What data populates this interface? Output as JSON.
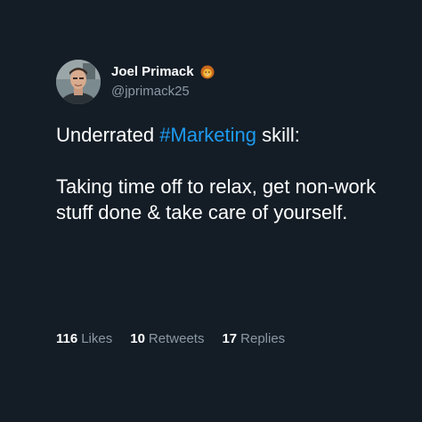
{
  "author": {
    "display_name": "Joel Primack",
    "handle": "@jprimack25",
    "avatar_icon": "profile-photo",
    "badge_icon": "lion-emoji"
  },
  "tweet": {
    "line1_prefix": "Underrated ",
    "hashtag": "#Marketing",
    "line1_suffix": " skill:",
    "line2": "Taking time off to relax, get non-work stuff done & take care of yourself."
  },
  "stats": {
    "likes_count": "116",
    "likes_label": "Likes",
    "retweets_count": "10",
    "retweets_label": "Retweets",
    "replies_count": "17",
    "replies_label": "Replies"
  },
  "colors": {
    "background": "#141d26",
    "text": "#ffffff",
    "muted": "#8b98a5",
    "hashtag": "#1d9bf0"
  }
}
